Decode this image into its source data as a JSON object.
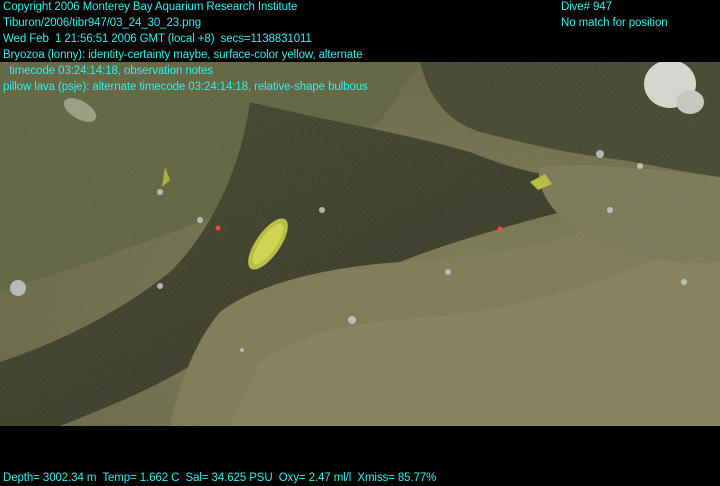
{
  "overlay": {
    "copyright": "Copyright 2006 Monterey Bay Aquarium Research Institute",
    "file": "Tiburon/2006/tibr947/03_24_30_23.png",
    "datetime": "Wed Feb  1 21:56:51 2006 GMT (local +8)  secs=1138831011",
    "annotation1_line1": "Bryozoa (lonny): identity-certainty maybe, surface-color yellow, alternate",
    "annotation1_line2": "  timecode 03:24:14:18, observation notes",
    "annotation2": "pillow lava (psje): alternate timecode 03:24:14:18, relative-shape bulbous",
    "dive": "Dive# 947",
    "position": "No match for position",
    "sensors": "Depth= 3002.34 m  Temp= 1.662 C  Sal= 34.625 PSU  Oxy= 2.47 ml/l  Xmiss= 85.77%"
  },
  "colors": {
    "overlay_text": "#2ff0f0",
    "seafloor": "#6f6f47",
    "crevice": "#2f3221",
    "bryozoan": "#c8d23a",
    "laser": "#ff3a20"
  },
  "scene": {
    "subject": "seafloor-pillow-lava-with-yellow-bryozoan"
  }
}
